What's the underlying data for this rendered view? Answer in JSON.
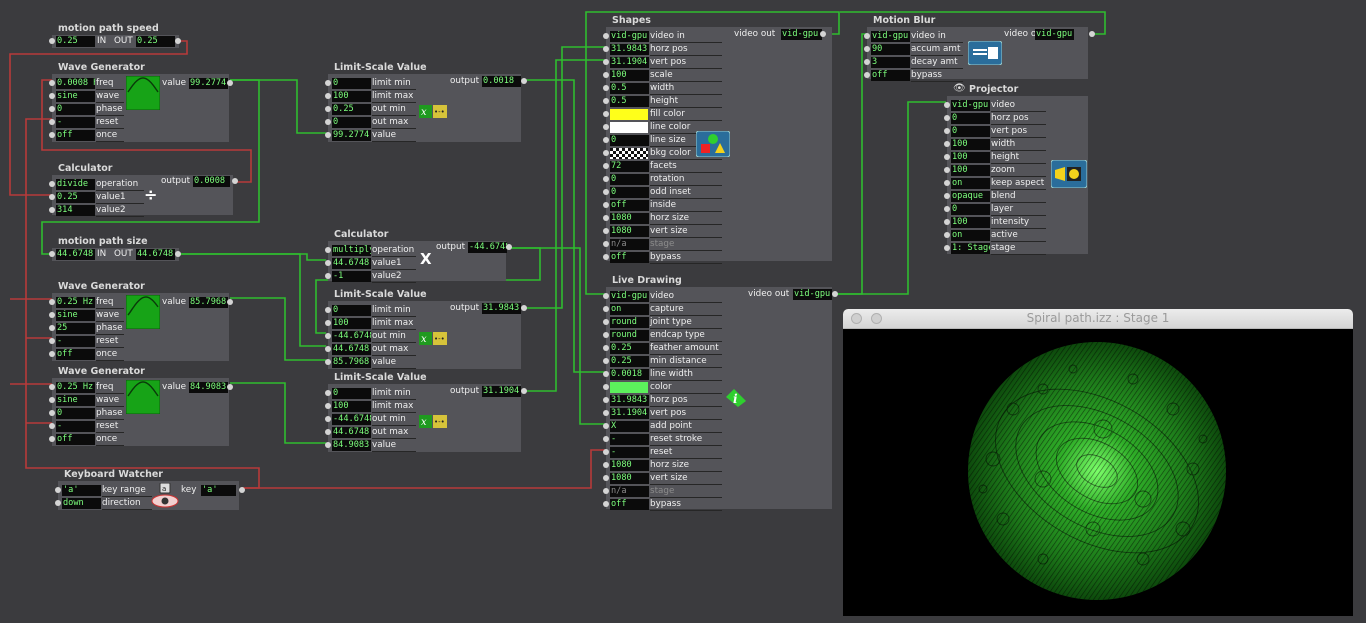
{
  "colors": {
    "value_text": "#7dff7d",
    "wire_green": "#2fbd2f",
    "wire_red": "#b73a3a",
    "panel": "#545459",
    "background": "#3b3b3e"
  },
  "motion_speed": {
    "title": "motion path speed",
    "in_value": "0.25",
    "in_label": "IN",
    "out_label": "OUT",
    "out_value": "0.25"
  },
  "wave1": {
    "title": "Wave Generator",
    "freq": "0.0008 Hz",
    "wave": "sine",
    "phase": "0",
    "reset": "-",
    "once": "off",
    "labels": [
      "freq",
      "wave",
      "phase",
      "reset",
      "once"
    ],
    "out_label": "value",
    "out_value": "99.2774"
  },
  "calc1": {
    "title": "Calculator",
    "operation": "divide",
    "value1": "0.25",
    "value2": "314",
    "labels": [
      "operation",
      "value1",
      "value2"
    ],
    "out_label": "output",
    "out_value": "0.0008",
    "symbol": "÷"
  },
  "motion_size": {
    "title": "motion path size",
    "in_value": "44.6748",
    "in_label": "IN",
    "out_label": "OUT",
    "out_value": "44.6748"
  },
  "wave2": {
    "title": "Wave Generator",
    "freq": "0.25 Hz",
    "wave": "sine",
    "phase": "25",
    "reset": "-",
    "once": "off",
    "labels": [
      "freq",
      "wave",
      "phase",
      "reset",
      "once"
    ],
    "out_label": "value",
    "out_value": "85.7968"
  },
  "wave3": {
    "title": "Wave Generator",
    "freq": "0.25 Hz",
    "wave": "sine",
    "phase": "0",
    "reset": "-",
    "once": "off",
    "labels": [
      "freq",
      "wave",
      "phase",
      "reset",
      "once"
    ],
    "out_label": "value",
    "out_value": "84.9083"
  },
  "keyboard": {
    "title": "Keyboard Watcher",
    "key_range": "'a'",
    "direction": "down",
    "labels": [
      "key range",
      "direction"
    ],
    "out_label": "key",
    "out_value": "'a'"
  },
  "lsv1": {
    "title": "Limit-Scale Value",
    "values": [
      "0",
      "100",
      "0.25",
      "0",
      "99.2774"
    ],
    "labels": [
      "limit min",
      "limit max",
      "out min",
      "out max",
      "value"
    ],
    "out_label": "output",
    "out_value": "0.0018"
  },
  "calc2": {
    "title": "Calculator",
    "operation": "multiply",
    "value1": "44.6748",
    "value2": "-1",
    "labels": [
      "operation",
      "value1",
      "value2"
    ],
    "out_label": "output",
    "out_value": "-44.6748",
    "symbol": "X"
  },
  "lsv2": {
    "title": "Limit-Scale Value",
    "values": [
      "0",
      "100",
      "-44.6748",
      "44.6748",
      "85.7968"
    ],
    "labels": [
      "limit min",
      "limit max",
      "out min",
      "out max",
      "value"
    ],
    "out_label": "output",
    "out_value": "31.9843"
  },
  "lsv3": {
    "title": "Limit-Scale Value",
    "values": [
      "0",
      "100",
      "-44.6748",
      "44.6748",
      "84.9083"
    ],
    "labels": [
      "limit min",
      "limit max",
      "out min",
      "out max",
      "value"
    ],
    "out_label": "output",
    "out_value": "31.1904"
  },
  "shapes": {
    "title": "Shapes",
    "values": [
      "vid-gpu",
      "31.9843",
      "31.1904",
      "100",
      "0.5",
      "0.5",
      "",
      "",
      "0",
      "",
      "72",
      "0",
      "0",
      "off",
      "1080",
      "1080",
      "n/a",
      "off"
    ],
    "labels": [
      "video in",
      "horz pos",
      "vert pos",
      "scale",
      "width",
      "height",
      "fill color",
      "line color",
      "line size",
      "bkg color",
      "facets",
      "rotation",
      "odd inset",
      "inside",
      "horz size",
      "vert size",
      "stage",
      "bypass"
    ],
    "out_label": "video out",
    "out_value": "vid-gpu",
    "fill_color": "#ffff1a",
    "line_color": "#ffffff"
  },
  "live": {
    "title": "Live Drawing",
    "values": [
      "vid-gpu",
      "on",
      "round",
      "round",
      "0.25",
      "0.25",
      "0.0018",
      "",
      "31.9843",
      "31.1904",
      "X",
      "-",
      "-",
      "1080",
      "1080",
      "n/a",
      "off"
    ],
    "labels": [
      "video",
      "capture",
      "joint type",
      "endcap type",
      "feather amount",
      "min distance",
      "line width",
      "color",
      "horz pos",
      "vert pos",
      "add point",
      "reset stroke",
      "reset",
      "horz size",
      "vert size",
      "stage",
      "bypass"
    ],
    "out_label": "video out",
    "out_value": "vid-gpu",
    "line_color": "#5cf05c"
  },
  "blur": {
    "title": "Motion Blur",
    "values": [
      "vid-gpu",
      "90",
      "3",
      "off"
    ],
    "labels": [
      "video in",
      "accum amt",
      "decay amt",
      "bypass"
    ],
    "out_label": "video out",
    "out_value": "vid-gpu"
  },
  "projector": {
    "title": "Projector",
    "values": [
      "vid-gpu",
      "0",
      "0",
      "100",
      "100",
      "100",
      "on",
      "opaque",
      "0",
      "100",
      "on",
      "1: Stage"
    ],
    "labels": [
      "video",
      "horz pos",
      "vert pos",
      "width",
      "height",
      "zoom",
      "keep aspect",
      "blend",
      "layer",
      "intensity",
      "active",
      "stage"
    ]
  },
  "stage": {
    "title": "Spiral path.izz : Stage 1"
  }
}
